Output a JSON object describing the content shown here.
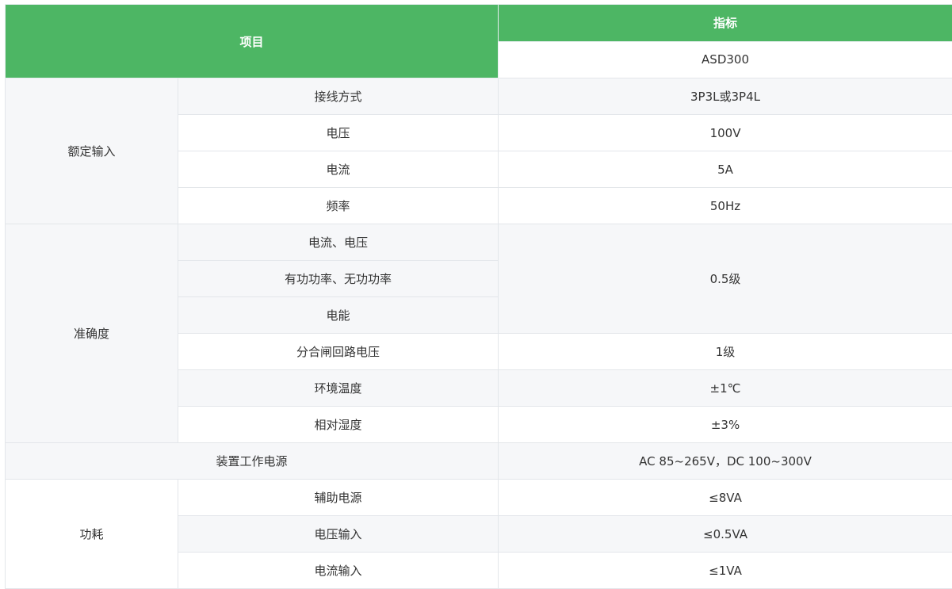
{
  "header": {
    "item": "项目",
    "spec": "指标",
    "model": "ASD300"
  },
  "rated_input": {
    "group": "额定输入",
    "rows": [
      {
        "label": "接线方式",
        "value": "3P3L或3P4L"
      },
      {
        "label": "电压",
        "value": "100V"
      },
      {
        "label": "电流",
        "value": "5A"
      },
      {
        "label": "频率",
        "value": "50Hz"
      }
    ]
  },
  "accuracy": {
    "group": "准确度",
    "rows": [
      {
        "label": "电流、电压"
      },
      {
        "label": "有功功率、无功功率"
      },
      {
        "label": "电能"
      },
      {
        "label": "分合闸回路电压",
        "value": "1级"
      },
      {
        "label": "环境温度",
        "value": "±1℃"
      },
      {
        "label": "相对湿度",
        "value": "±3%"
      }
    ],
    "merged_value": "0.5级"
  },
  "power_supply": {
    "label": "装置工作电源",
    "value": "AC 85~265V，DC 100~300V"
  },
  "consumption": {
    "group": "功耗",
    "rows": [
      {
        "label": "辅助电源",
        "value": "≤8VA"
      },
      {
        "label": "电压输入",
        "value": "≤0.5VA"
      },
      {
        "label": "电流输入",
        "value": "≤1VA"
      }
    ]
  }
}
